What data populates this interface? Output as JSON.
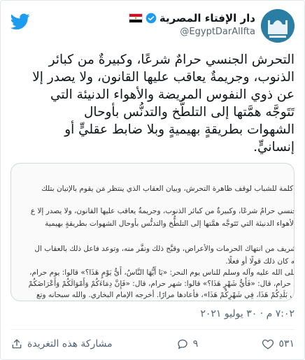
{
  "account": {
    "name": "دار الإفتاء المصرية",
    "handle": "@EgyptDarAlIfta"
  },
  "tweet": {
    "text_lines": [
      "التحرش الجنسي حرامٌ شرعًا، وكبيرةٌ من كبائر",
      "الذنوب، وجريمةٌ يعاقب عليها القانون، ولا يصدر إلا",
      "عن ذوي النفوس المريضة والأهواء الدنيئة التي",
      "تَتَوجَّه همَّتها إلى التلطُّخ والتدنُّس بأوحال",
      "الشهوات بطريقةٍ بهيميةٍ وبلا ضابط عقليٍّ أو",
      "إنسانيٍّ."
    ],
    "timestamp": "٧:٠٢ م · ٣٠ يوليو ٢٠٢١"
  },
  "media": {
    "lines": [
      "ه كلمة للشباب لوقف ظاهرة التحرش، وبيان العقاب الذي ينتظر مَن يقوم بالإتيان بتلك",
      "لجنسي حرامٌ شرعًا، وكبيرةٌ من كبائر الذنوب، وجريمةٌ يعاقب عليها القانون، ولا يصدر إلا ع",
      "والأهواء الدنيئة التي تَتَوجَّه همَّتها إلى التلطُّخ والتدنُّس بأوحال الشهوات بطريقةٍ بهيمية",
      "لشريف من انتهاك الحرمات والأعراض، وقبَّح ذلك ونفَّر منه، وتوعد فاعل ذلك بالعقاب ال",
      "لله كان ذلك قولًا أو فعلًا.",
      "صلى الله عليه وآله وسلم للناس يوم النحر: «يَا أَيُّهَا النَّاسُ، أَيُّ يَوْمٍ هَذَا؟» قالوا: يوم حرام،",
      "لد حرام، قال: «فَأَيُّ شَهْرٍ هَذَا؟» قالوا: شهر حرام، قال: «فَإِنَّ دِمَاءَكُمْ وَأَمْوَالَكُمْ وَأَعْرَاضَكُمْ",
      "في بَلَدِكُمْ هَذَا، فِي شَهْرِكُمْ هَذَا»، فأعادها مرارًا. أخرجه الإمام البخاري. والله سبحانه وتع"
    ]
  },
  "actions": {
    "likes": "٥٣١",
    "replies": "٩",
    "share_label": "مشاركة هذه التغريدة"
  },
  "colors": {
    "twitter_blue": "#1d9bf0",
    "text": "#0f1419",
    "muted": "#536471"
  }
}
